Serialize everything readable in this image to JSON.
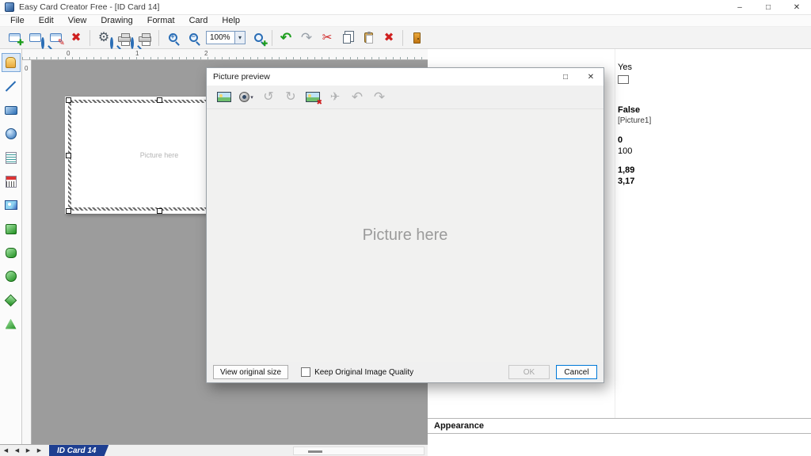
{
  "colors": {
    "accent": "#0078d7",
    "tab-blue": "#1e3f91",
    "canvas-gray": "#9c9c9c",
    "green": "#1e9e1e",
    "red": "#cf2020"
  },
  "titlebar": {
    "title": "Easy Card Creator Free - [ID Card 14]"
  },
  "menubar": {
    "items": [
      "File",
      "Edit",
      "View",
      "Drawing",
      "Format",
      "Card",
      "Help"
    ]
  },
  "toolbar": {
    "zoom_value": "100%"
  },
  "icons": {
    "plus": "✚",
    "pencil": "✎",
    "cross": "✖",
    "gear": "⚙",
    "scissors": "✂",
    "undo": "↶",
    "redo": "↷",
    "rotate_left": "↺",
    "rotate_right": "↻",
    "plane": "✈",
    "dropdown": "▾",
    "minimize": "–",
    "maximize": "□",
    "close": "✕",
    "nav_first": "◀",
    "nav_prev": "◀",
    "nav_next": "▶",
    "nav_last": "▶",
    "zoom_in": "+",
    "zoom_out": "−"
  },
  "ruler": {
    "h": [
      "0",
      "1",
      "2"
    ],
    "v": [
      "0"
    ]
  },
  "canvas": {
    "card_placeholder": "Picture here"
  },
  "dialog": {
    "title": "Picture preview",
    "placeholder": "Picture here",
    "view_original_button": "View original size",
    "quality_checkbox_label": "Keep Original Image Quality",
    "ok_button": "OK",
    "cancel_button": "Cancel"
  },
  "properties": {
    "rows": [
      {
        "value": "Yes"
      },
      {
        "value": "False"
      },
      {
        "value": "[Picture1]"
      },
      {
        "value": "0"
      },
      {
        "value": "100"
      },
      {
        "value": "1,89"
      },
      {
        "value": "3,17"
      }
    ],
    "appearance_header": "Appearance"
  },
  "tabbar": {
    "tab_label": "ID Card 14"
  }
}
